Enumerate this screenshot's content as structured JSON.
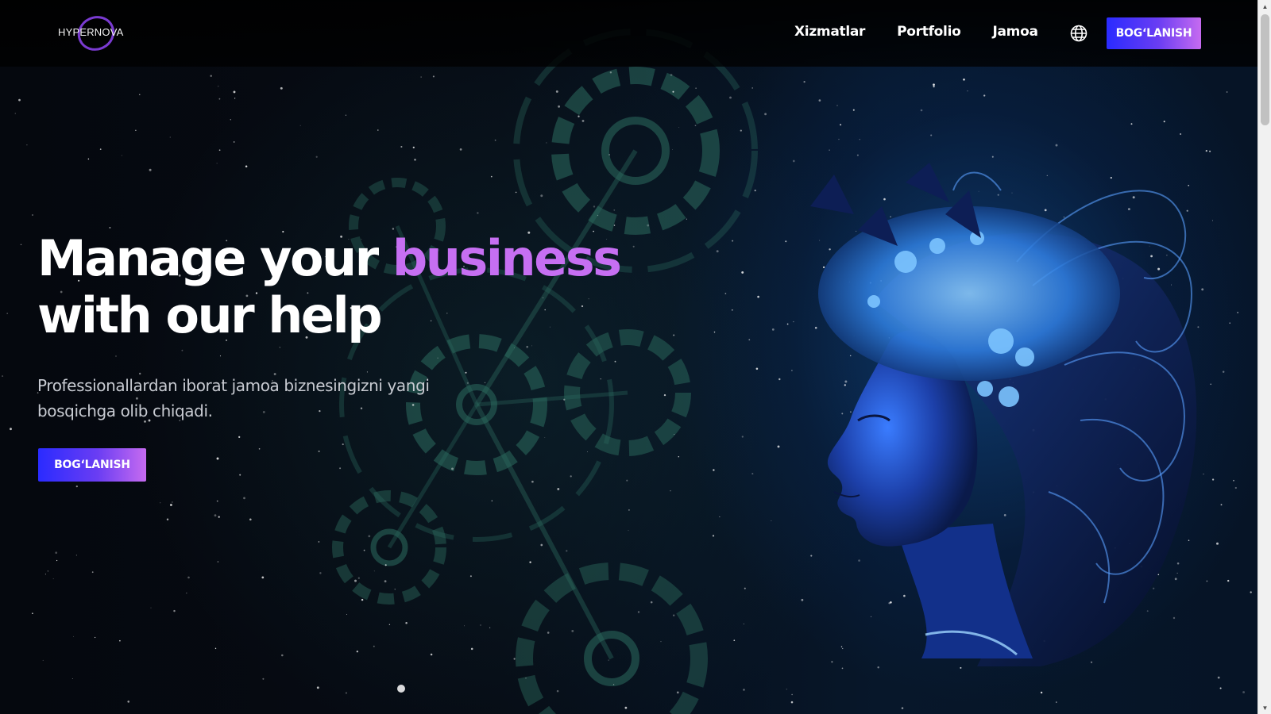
{
  "brand": {
    "logo_text": "HYPERNOVA"
  },
  "nav": {
    "items": [
      {
        "label": "Xizmatlar"
      },
      {
        "label": "Portfolio"
      },
      {
        "label": "Jamoa"
      }
    ],
    "language_icon": "globe-icon",
    "cta_label": "BOG‘LANISH"
  },
  "hero": {
    "title_part1": "Manage your ",
    "title_accent": "business",
    "title_part2": "with our help",
    "subtitle": "Professionallardan iborat jamoa biznesingizni yangi bosqichga olib chiqadi.",
    "cta_label": "BOG‘LANISH"
  },
  "colors": {
    "accent_purple": "#c66ff2",
    "button_gradient_start": "#2a2bff",
    "button_gradient_end": "#c66bf0",
    "background": "#05080e"
  }
}
